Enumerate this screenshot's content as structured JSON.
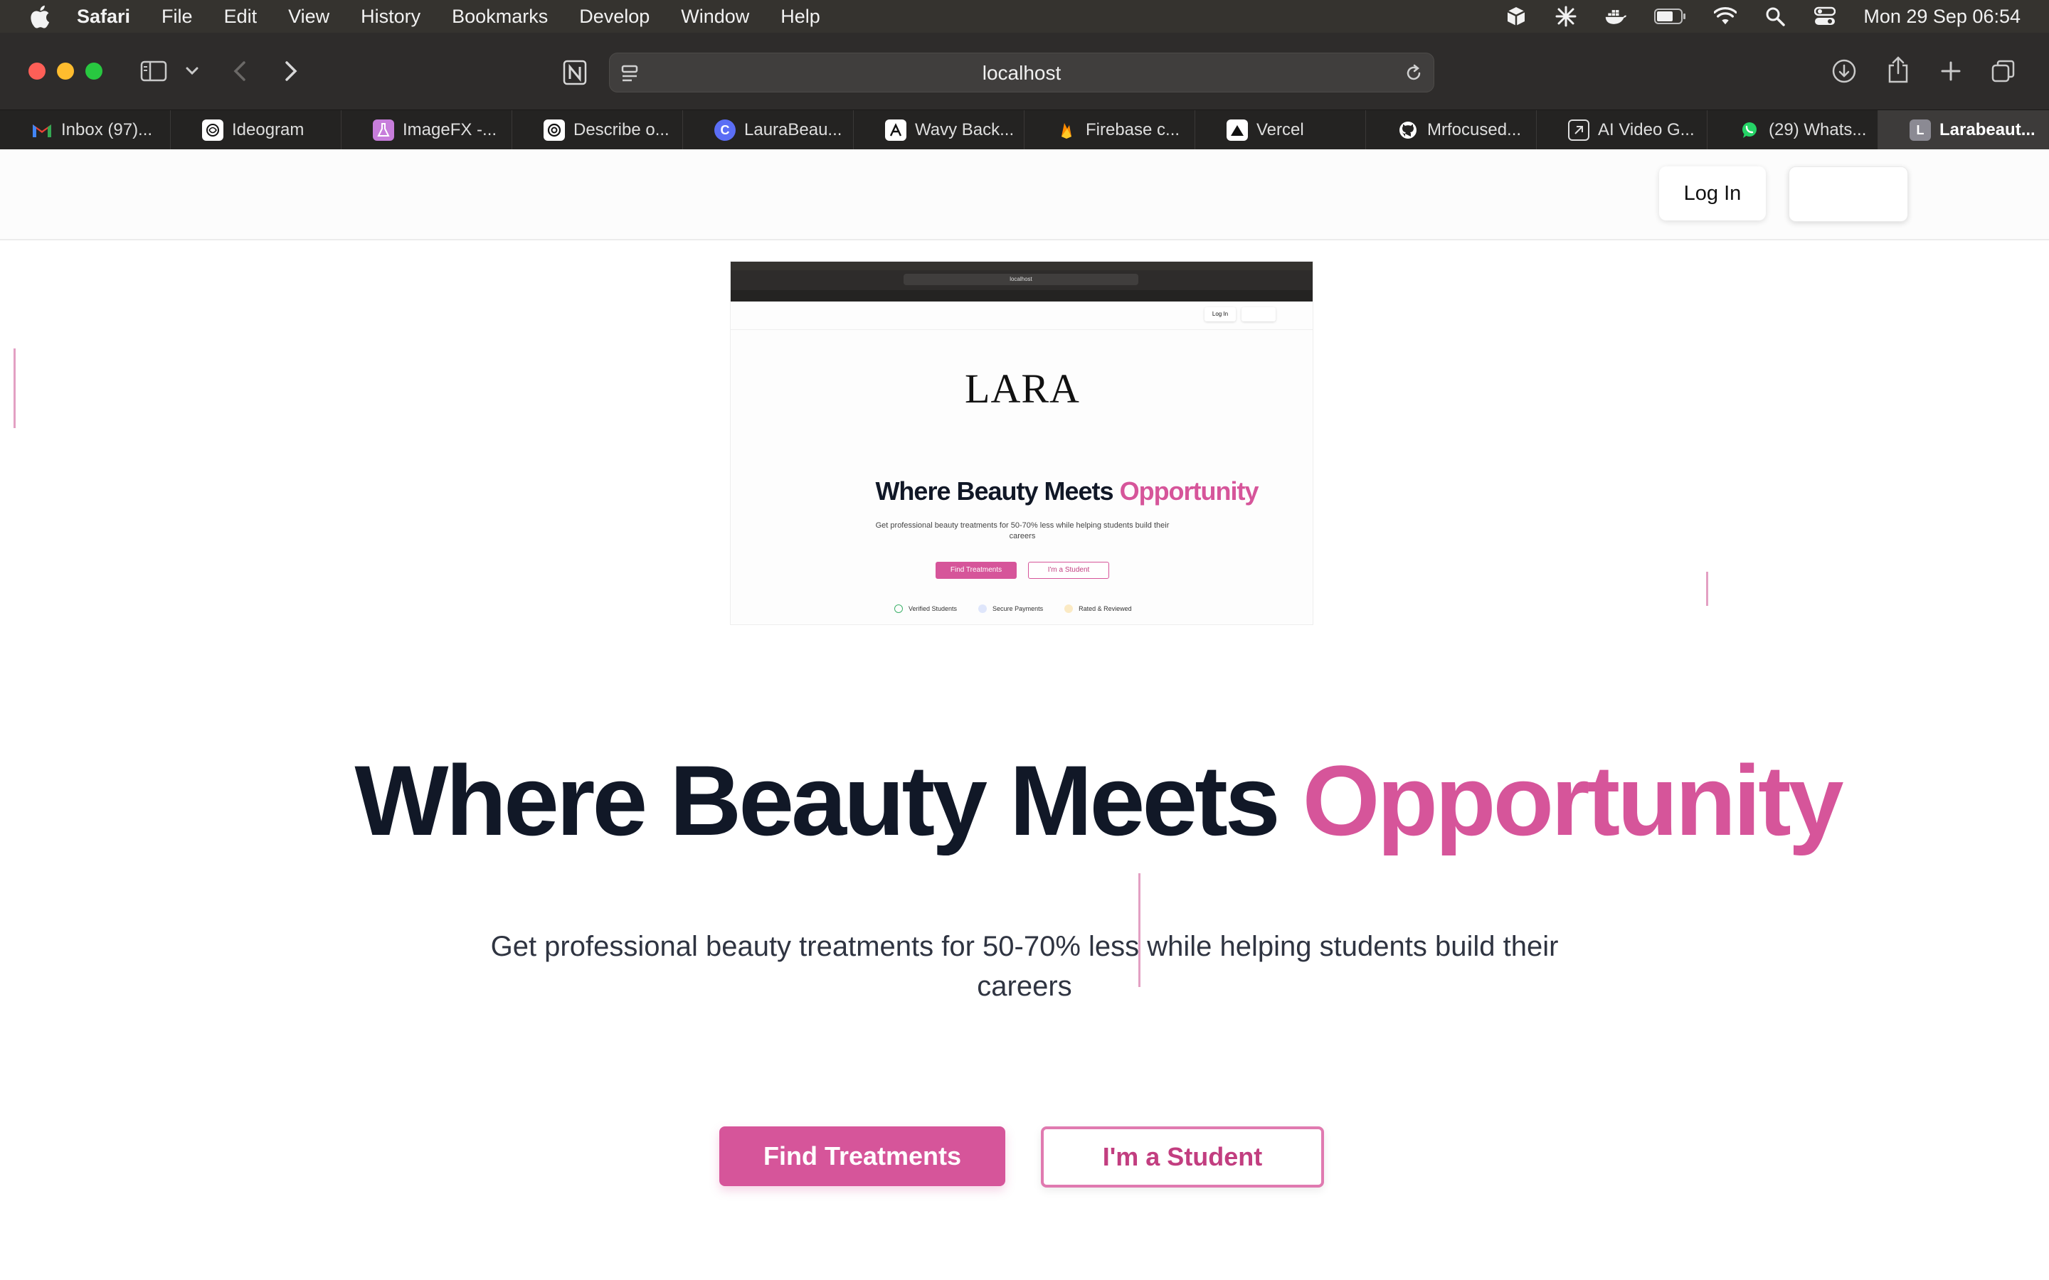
{
  "menubar": {
    "app_name": "Safari",
    "items": [
      "File",
      "Edit",
      "View",
      "History",
      "Bookmarks",
      "Develop",
      "Window",
      "Help"
    ],
    "clock": "Mon 29 Sep  06:54"
  },
  "browser": {
    "url": "localhost",
    "tabs": [
      {
        "label": "Inbox (97)...",
        "icon": "gmail-icon",
        "color": "#ea4335"
      },
      {
        "label": "Ideogram",
        "icon": "ideogram-icon",
        "color": "#ffffff"
      },
      {
        "label": "ImageFX -...",
        "icon": "imagefx-icon",
        "color": "#c77ddb"
      },
      {
        "label": "Describe o...",
        "icon": "openai-icon",
        "color": "#ffffff"
      },
      {
        "label": "LauraBeau...",
        "icon": "canva-icon",
        "color": "#5b6ef5"
      },
      {
        "label": "Wavy Back...",
        "icon": "wavy-icon",
        "color": "#ffffff"
      },
      {
        "label": "Firebase c...",
        "icon": "firebase-icon",
        "color": "#ff8a00"
      },
      {
        "label": "Vercel",
        "icon": "vercel-icon",
        "color": "#ffffff"
      },
      {
        "label": "Mrfocused...",
        "icon": "github-icon",
        "color": "#ffffff"
      },
      {
        "label": "AI Video G...",
        "icon": "ai-video-icon",
        "color": "#ffffff"
      },
      {
        "label": "(29) Whats...",
        "icon": "whatsapp-icon",
        "color": "#25d366"
      },
      {
        "label": "Larabeaut...",
        "icon": "lara-tab-icon",
        "color": "#8b8a93",
        "active": true
      }
    ]
  },
  "site": {
    "login_label": "Log In",
    "hero_title_main": "Where Beauty Meets",
    "hero_title_accent": "Opportunity",
    "hero_subtitle": "Get professional beauty treatments for 50-70% less while helping students build their careers",
    "find_treatments_label": "Find Treatments",
    "student_label": "I'm a Student"
  },
  "preview": {
    "logo": "LARA",
    "url": "localhost",
    "login_label": "Log In",
    "title_main": "Where Beauty Meets",
    "title_accent": "Opportunity",
    "subtitle": "Get professional beauty treatments for 50-70% less while helping students build their careers",
    "find_label": "Find Treatments",
    "student_label": "I'm a Student",
    "badges": [
      "Verified Students",
      "Secure Payments",
      "Rated & Reviewed"
    ]
  },
  "colors": {
    "accent_pink": "#d6559a",
    "heading_dark": "#111827",
    "menubar_bg": "#35332f",
    "toolbar_bg": "#2e2c2b"
  }
}
